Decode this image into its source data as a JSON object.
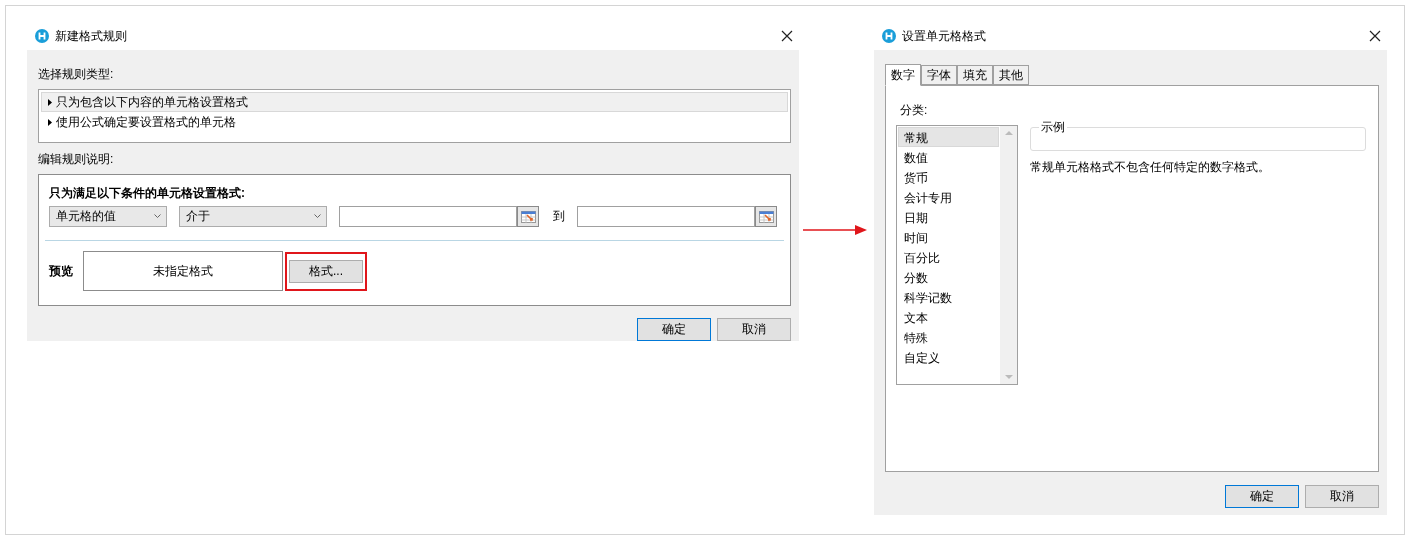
{
  "rule_dialog": {
    "title": "新建格式规则",
    "rule_type_label": "选择规则类型:",
    "rule_types": [
      {
        "label": "只为包含以下内容的单元格设置格式",
        "selected": true
      },
      {
        "label": "使用公式确定要设置格式的单元格",
        "selected": false
      }
    ],
    "description_label": "编辑规则说明:",
    "condition_label": "只为满足以下条件的单元格设置格式:",
    "value_select": "单元格的值",
    "operator_select": "介于",
    "to_label": "到",
    "preview_label": "预览",
    "preview_text": "未指定格式",
    "format_button": {
      "label": "格式...",
      "highlighted": true
    },
    "buttons": [
      {
        "label": "确定",
        "default": true
      },
      {
        "label": "取消",
        "default": false
      }
    ]
  },
  "format_dialog": {
    "title": "设置单元格格式",
    "tabs": [
      {
        "label": "数字",
        "selected": true
      },
      {
        "label": "字体",
        "selected": false
      },
      {
        "label": "填充",
        "selected": false
      },
      {
        "label": "其他",
        "selected": false
      }
    ],
    "category_label": "分类:",
    "categories": [
      {
        "label": "常规",
        "selected": true
      },
      {
        "label": "数值",
        "selected": false
      },
      {
        "label": "货币",
        "selected": false
      },
      {
        "label": "会计专用",
        "selected": false
      },
      {
        "label": "日期",
        "selected": false
      },
      {
        "label": "时间",
        "selected": false
      },
      {
        "label": "百分比",
        "selected": false
      },
      {
        "label": "分数",
        "selected": false
      },
      {
        "label": "科学记数",
        "selected": false
      },
      {
        "label": "文本",
        "selected": false
      },
      {
        "label": "特殊",
        "selected": false
      },
      {
        "label": "自定义",
        "selected": false
      }
    ],
    "sample_legend": "示例",
    "description": "常规单元格格式不包含任何特定的数字格式。",
    "buttons": [
      {
        "label": "确定",
        "default": true
      },
      {
        "label": "取消",
        "default": false
      }
    ]
  }
}
